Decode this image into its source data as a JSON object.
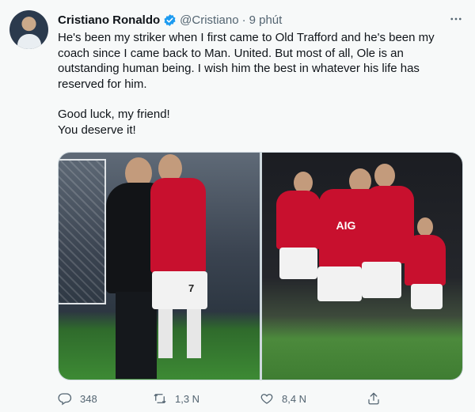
{
  "author": {
    "name": "Cristiano Ronaldo",
    "handle": "@Cristiano",
    "separator": "·",
    "time": "9 phút"
  },
  "tweet": {
    "paragraph1": "He's been my striker when I first came to Old Trafford and he's been my coach since I came back to Man. United. But most of all, Ole is an outstanding human being. I wish him the best in whatever his life has reserved for him.",
    "line2": "Good luck, my friend!",
    "line3": "You deserve it!"
  },
  "photos": {
    "left_shirt_number": "7",
    "right_shirt_text": "AIG"
  },
  "actions": {
    "replies": "348",
    "retweets": "1,3 N",
    "likes": "8,4 N"
  },
  "colors": {
    "verified": "#1d9bf0",
    "muted": "#536471",
    "united_red": "#c8102e"
  },
  "icons": [
    "avatar",
    "verified-badge-icon",
    "more-icon",
    "reply-icon",
    "retweet-icon",
    "like-icon",
    "share-icon"
  ]
}
